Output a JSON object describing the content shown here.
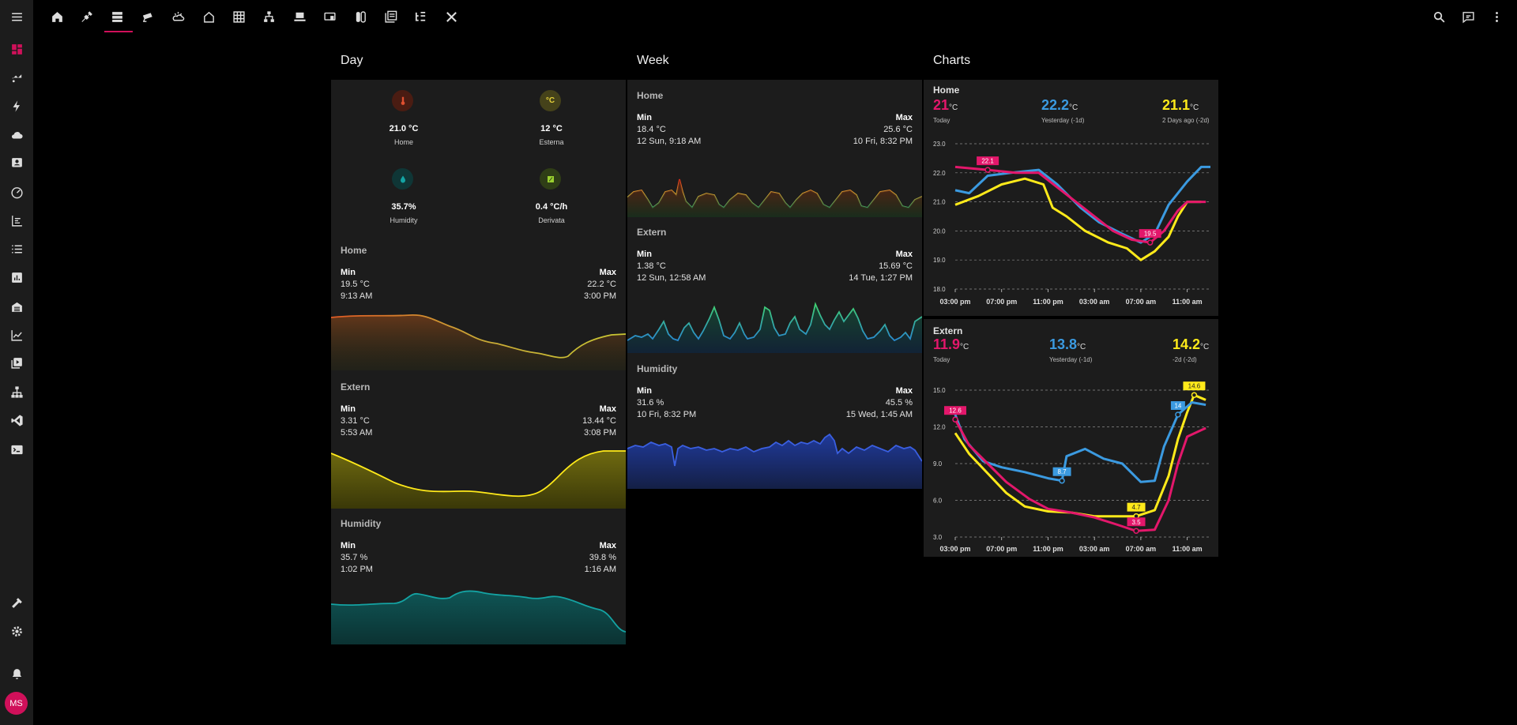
{
  "nav": {
    "sidebar_items": [
      "dashboard-icon",
      "energy-icon",
      "lightning-icon",
      "cloud-icon",
      "contact-icon",
      "gauge-icon",
      "timeline-icon",
      "list-icon",
      "bar-chart-icon",
      "garage-icon",
      "line-chart-icon",
      "media-icon",
      "network-icon",
      "vscode-icon",
      "terminal-icon"
    ],
    "sidebar_bottom": [
      "hammer-icon",
      "settings-icon",
      "bell-icon"
    ],
    "user_initials": "MS",
    "top_tabs": [
      "home-icon",
      "plug-icon",
      "server-icon",
      "camera-icon",
      "weather-icon",
      "house-outline-icon",
      "grid-icon",
      "hierarchy-icon",
      "laptop-icon",
      "monitor-icon",
      "switch-icon",
      "panel-icon",
      "tree-icon",
      "tools-icon"
    ],
    "accent": "#d0105a"
  },
  "day": {
    "title": "Day",
    "badges": [
      {
        "value": "21.0 °C",
        "name": "Home",
        "icon": "thermometer-icon",
        "color": "#e05030",
        "bg": "#4a1c12"
      },
      {
        "value": "12 °C",
        "name": "Esterna",
        "icon": "°C",
        "color": "#e6d23a",
        "bg": "#45421a"
      },
      {
        "value": "35.7%",
        "name": "Humidity",
        "icon": "water-drop-icon",
        "color": "#14a3a3",
        "bg": "#0f3636"
      },
      {
        "value": "0.4 °C/h",
        "name": "Derivata",
        "icon": "slope-icon",
        "color": "#9ad030",
        "bg": "#2f3e16"
      }
    ],
    "sections": [
      {
        "label": "Home",
        "min": "Min",
        "max": "Max",
        "min_val": "19.5 °C",
        "min_time": "9:13 AM",
        "max_val": "22.2 °C",
        "max_time": "3:00 PM"
      },
      {
        "label": "Extern",
        "min": "Min",
        "max": "Max",
        "min_val": "3.31 °C",
        "min_time": "5:53 AM",
        "max_val": "13.44 °C",
        "max_time": "3:08 PM"
      },
      {
        "label": "Humidity",
        "min": "Min",
        "max": "Max",
        "min_val": "35.7 %",
        "min_time": "1:02 PM",
        "max_val": "39.8 %",
        "max_time": "1:16 AM"
      }
    ]
  },
  "week": {
    "title": "Week",
    "sections": [
      {
        "label": "Home",
        "min": "Min",
        "max": "Max",
        "min_val": "18.4 °C",
        "min_time": "12 Sun, 9:18 AM",
        "max_val": "25.6 °C",
        "max_time": "10 Fri, 8:32 PM"
      },
      {
        "label": "Extern",
        "min": "Min",
        "max": "Max",
        "min_val": "1.38 °C",
        "min_time": "12 Sun, 12:58 AM",
        "max_val": "15.69 °C",
        "max_time": "14 Tue, 1:27 PM"
      },
      {
        "label": "Humidity",
        "min": "Min",
        "max": "Max",
        "min_val": "31.6 %",
        "min_time": "10 Fri, 8:32 PM",
        "max_val": "45.5 %",
        "max_time": "15 Wed, 1:45 AM"
      }
    ]
  },
  "charts": {
    "title": "Charts",
    "home": {
      "label": "Home",
      "summaries": [
        {
          "value": "21",
          "unit": "°C",
          "sub": "Today",
          "color": "#e3176b"
        },
        {
          "value": "22.2",
          "unit": "°C",
          "sub": "Yesterday (-1d)",
          "color": "#3b9ae0"
        },
        {
          "value": "21.1",
          "unit": "°C",
          "sub": "2 Days ago (-2d)",
          "color": "#ffea1a"
        }
      ],
      "markers": [
        "22.1",
        "19.5"
      ]
    },
    "extern": {
      "label": "Extern",
      "summaries": [
        {
          "value": "11.9",
          "unit": "°C",
          "sub": "Today",
          "color": "#e3176b"
        },
        {
          "value": "13.8",
          "unit": "°C",
          "sub": "Yesterday (-1d)",
          "color": "#3b9ae0"
        },
        {
          "value": "14.2",
          "unit": "°C",
          "sub": "-2d (-2d)",
          "color": "#ffea1a"
        }
      ],
      "markers": [
        "12.6",
        "8.7",
        "4.7",
        "3.5",
        "14",
        "14.6"
      ]
    }
  },
  "chart_data": [
    {
      "type": "line",
      "title": "Home",
      "x": [
        "03:00 pm",
        "07:00 pm",
        "11:00 pm",
        "03:00 am",
        "07:00 am",
        "11:00 am"
      ],
      "ylim": [
        18.0,
        23.0
      ],
      "yticks": [
        "23.0",
        "22.0",
        "21.0",
        "20.0",
        "19.0",
        "18.0"
      ],
      "grid": true,
      "series": [
        {
          "name": "Today",
          "color": "#e3176b",
          "points": [
            [
              0,
              22.2
            ],
            [
              0.7,
              22.1
            ],
            [
              1.3,
              22.0
            ],
            [
              1.8,
              22.0
            ],
            [
              2.2,
              21.5
            ],
            [
              2.6,
              21.0
            ],
            [
              3.0,
              20.5
            ],
            [
              3.4,
              20.0
            ],
            [
              3.8,
              19.7
            ],
            [
              4.2,
              19.6
            ],
            [
              4.5,
              20.0
            ],
            [
              4.8,
              20.7
            ],
            [
              5.0,
              21.0
            ],
            [
              5.4,
              21.0
            ]
          ]
        },
        {
          "name": "Yesterday (-1d)",
          "color": "#3b9ae0",
          "points": [
            [
              0,
              21.4
            ],
            [
              0.3,
              21.3
            ],
            [
              0.7,
              21.9
            ],
            [
              1.2,
              22.0
            ],
            [
              1.8,
              22.1
            ],
            [
              2.2,
              21.6
            ],
            [
              2.7,
              20.8
            ],
            [
              3.1,
              20.3
            ],
            [
              3.6,
              19.9
            ],
            [
              4.0,
              19.6
            ],
            [
              4.3,
              19.9
            ],
            [
              4.6,
              20.9
            ],
            [
              5.0,
              21.7
            ],
            [
              5.3,
              22.2
            ],
            [
              5.5,
              22.2
            ]
          ]
        },
        {
          "name": "2 Days ago (-2d)",
          "color": "#ffea1a",
          "points": [
            [
              0,
              20.9
            ],
            [
              0.5,
              21.2
            ],
            [
              1.0,
              21.6
            ],
            [
              1.5,
              21.8
            ],
            [
              1.9,
              21.6
            ],
            [
              2.1,
              20.8
            ],
            [
              2.4,
              20.5
            ],
            [
              2.8,
              20.0
            ],
            [
              3.3,
              19.6
            ],
            [
              3.7,
              19.4
            ],
            [
              4.0,
              19.0
            ],
            [
              4.3,
              19.3
            ],
            [
              4.6,
              19.8
            ],
            [
              4.8,
              20.5
            ],
            [
              5.0,
              21.0
            ],
            [
              5.3,
              21.0
            ]
          ]
        }
      ]
    },
    {
      "type": "line",
      "title": "Extern",
      "x": [
        "03:00 pm",
        "07:00 pm",
        "11:00 pm",
        "03:00 am",
        "07:00 am",
        "11:00 am"
      ],
      "ylim": [
        3.0,
        15.0
      ],
      "yticks": [
        "15.0",
        "12.0",
        "9.0",
        "6.0",
        "3.0"
      ],
      "grid": true,
      "series": [
        {
          "name": "Today",
          "color": "#e3176b",
          "points": [
            [
              0,
              12.6
            ],
            [
              0.3,
              10.5
            ],
            [
              0.7,
              9.0
            ],
            [
              1.1,
              7.5
            ],
            [
              1.6,
              6.1
            ],
            [
              2.0,
              5.3
            ],
            [
              2.5,
              5.0
            ],
            [
              3.0,
              4.6
            ],
            [
              3.5,
              4.0
            ],
            [
              3.9,
              3.5
            ],
            [
              4.3,
              3.6
            ],
            [
              4.6,
              6.0
            ],
            [
              4.8,
              9.0
            ],
            [
              5.0,
              11.2
            ],
            [
              5.4,
              11.9
            ]
          ]
        },
        {
          "name": "Yesterday (-1d)",
          "color": "#3b9ae0",
          "points": [
            [
              0,
              13.0
            ],
            [
              0.2,
              11.0
            ],
            [
              0.6,
              9.2
            ],
            [
              1.0,
              8.7
            ],
            [
              1.5,
              8.3
            ],
            [
              2.0,
              7.8
            ],
            [
              2.3,
              7.6
            ],
            [
              2.4,
              9.6
            ],
            [
              2.8,
              10.2
            ],
            [
              3.2,
              9.4
            ],
            [
              3.6,
              9.0
            ],
            [
              4.0,
              7.5
            ],
            [
              4.3,
              7.6
            ],
            [
              4.5,
              10.4
            ],
            [
              4.8,
              13.0
            ],
            [
              5.1,
              14.0
            ],
            [
              5.4,
              13.8
            ]
          ]
        },
        {
          "name": "-2d (-2d)",
          "color": "#ffea1a",
          "points": [
            [
              0,
              11.5
            ],
            [
              0.3,
              9.8
            ],
            [
              0.7,
              8.2
            ],
            [
              1.1,
              6.6
            ],
            [
              1.5,
              5.5
            ],
            [
              2.0,
              5.1
            ],
            [
              2.5,
              5.0
            ],
            [
              3.0,
              4.7
            ],
            [
              3.5,
              4.7
            ],
            [
              3.9,
              4.7
            ],
            [
              4.3,
              5.2
            ],
            [
              4.6,
              8.0
            ],
            [
              4.8,
              11.0
            ],
            [
              5.0,
              13.2
            ],
            [
              5.15,
              14.6
            ],
            [
              5.4,
              14.2
            ]
          ]
        }
      ]
    }
  ]
}
